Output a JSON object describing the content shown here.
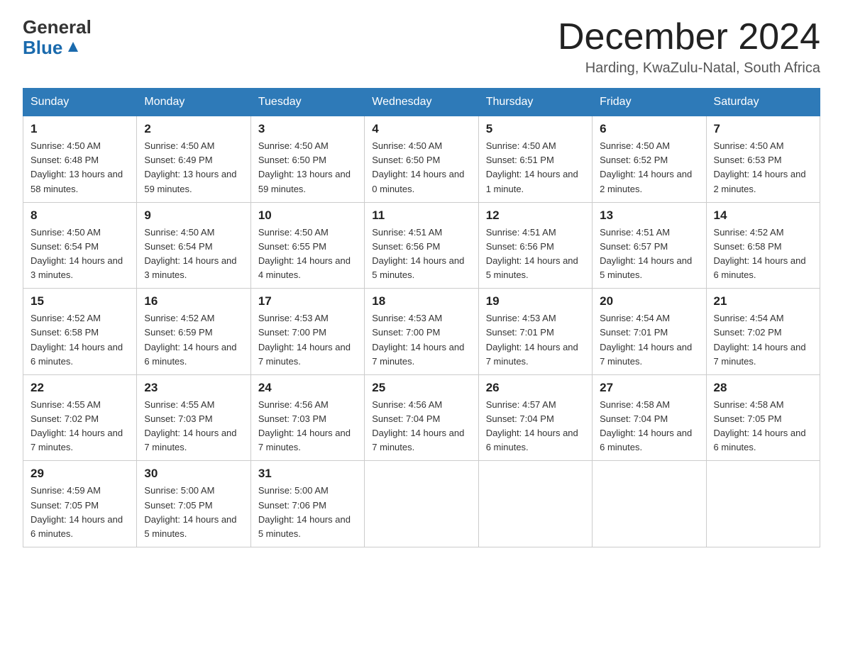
{
  "header": {
    "logo": {
      "line1": "General",
      "line2": "Blue"
    },
    "title": "December 2024",
    "location": "Harding, KwaZulu-Natal, South Africa"
  },
  "calendar": {
    "weekdays": [
      "Sunday",
      "Monday",
      "Tuesday",
      "Wednesday",
      "Thursday",
      "Friday",
      "Saturday"
    ],
    "weeks": [
      [
        {
          "day": "1",
          "sunrise": "4:50 AM",
          "sunset": "6:48 PM",
          "daylight": "13 hours and 58 minutes."
        },
        {
          "day": "2",
          "sunrise": "4:50 AM",
          "sunset": "6:49 PM",
          "daylight": "13 hours and 59 minutes."
        },
        {
          "day": "3",
          "sunrise": "4:50 AM",
          "sunset": "6:50 PM",
          "daylight": "13 hours and 59 minutes."
        },
        {
          "day": "4",
          "sunrise": "4:50 AM",
          "sunset": "6:50 PM",
          "daylight": "14 hours and 0 minutes."
        },
        {
          "day": "5",
          "sunrise": "4:50 AM",
          "sunset": "6:51 PM",
          "daylight": "14 hours and 1 minute."
        },
        {
          "day": "6",
          "sunrise": "4:50 AM",
          "sunset": "6:52 PM",
          "daylight": "14 hours and 2 minutes."
        },
        {
          "day": "7",
          "sunrise": "4:50 AM",
          "sunset": "6:53 PM",
          "daylight": "14 hours and 2 minutes."
        }
      ],
      [
        {
          "day": "8",
          "sunrise": "4:50 AM",
          "sunset": "6:54 PM",
          "daylight": "14 hours and 3 minutes."
        },
        {
          "day": "9",
          "sunrise": "4:50 AM",
          "sunset": "6:54 PM",
          "daylight": "14 hours and 3 minutes."
        },
        {
          "day": "10",
          "sunrise": "4:50 AM",
          "sunset": "6:55 PM",
          "daylight": "14 hours and 4 minutes."
        },
        {
          "day": "11",
          "sunrise": "4:51 AM",
          "sunset": "6:56 PM",
          "daylight": "14 hours and 5 minutes."
        },
        {
          "day": "12",
          "sunrise": "4:51 AM",
          "sunset": "6:56 PM",
          "daylight": "14 hours and 5 minutes."
        },
        {
          "day": "13",
          "sunrise": "4:51 AM",
          "sunset": "6:57 PM",
          "daylight": "14 hours and 5 minutes."
        },
        {
          "day": "14",
          "sunrise": "4:52 AM",
          "sunset": "6:58 PM",
          "daylight": "14 hours and 6 minutes."
        }
      ],
      [
        {
          "day": "15",
          "sunrise": "4:52 AM",
          "sunset": "6:58 PM",
          "daylight": "14 hours and 6 minutes."
        },
        {
          "day": "16",
          "sunrise": "4:52 AM",
          "sunset": "6:59 PM",
          "daylight": "14 hours and 6 minutes."
        },
        {
          "day": "17",
          "sunrise": "4:53 AM",
          "sunset": "7:00 PM",
          "daylight": "14 hours and 7 minutes."
        },
        {
          "day": "18",
          "sunrise": "4:53 AM",
          "sunset": "7:00 PM",
          "daylight": "14 hours and 7 minutes."
        },
        {
          "day": "19",
          "sunrise": "4:53 AM",
          "sunset": "7:01 PM",
          "daylight": "14 hours and 7 minutes."
        },
        {
          "day": "20",
          "sunrise": "4:54 AM",
          "sunset": "7:01 PM",
          "daylight": "14 hours and 7 minutes."
        },
        {
          "day": "21",
          "sunrise": "4:54 AM",
          "sunset": "7:02 PM",
          "daylight": "14 hours and 7 minutes."
        }
      ],
      [
        {
          "day": "22",
          "sunrise": "4:55 AM",
          "sunset": "7:02 PM",
          "daylight": "14 hours and 7 minutes."
        },
        {
          "day": "23",
          "sunrise": "4:55 AM",
          "sunset": "7:03 PM",
          "daylight": "14 hours and 7 minutes."
        },
        {
          "day": "24",
          "sunrise": "4:56 AM",
          "sunset": "7:03 PM",
          "daylight": "14 hours and 7 minutes."
        },
        {
          "day": "25",
          "sunrise": "4:56 AM",
          "sunset": "7:04 PM",
          "daylight": "14 hours and 7 minutes."
        },
        {
          "day": "26",
          "sunrise": "4:57 AM",
          "sunset": "7:04 PM",
          "daylight": "14 hours and 6 minutes."
        },
        {
          "day": "27",
          "sunrise": "4:58 AM",
          "sunset": "7:04 PM",
          "daylight": "14 hours and 6 minutes."
        },
        {
          "day": "28",
          "sunrise": "4:58 AM",
          "sunset": "7:05 PM",
          "daylight": "14 hours and 6 minutes."
        }
      ],
      [
        {
          "day": "29",
          "sunrise": "4:59 AM",
          "sunset": "7:05 PM",
          "daylight": "14 hours and 6 minutes."
        },
        {
          "day": "30",
          "sunrise": "5:00 AM",
          "sunset": "7:05 PM",
          "daylight": "14 hours and 5 minutes."
        },
        {
          "day": "31",
          "sunrise": "5:00 AM",
          "sunset": "7:06 PM",
          "daylight": "14 hours and 5 minutes."
        },
        null,
        null,
        null,
        null
      ]
    ]
  }
}
